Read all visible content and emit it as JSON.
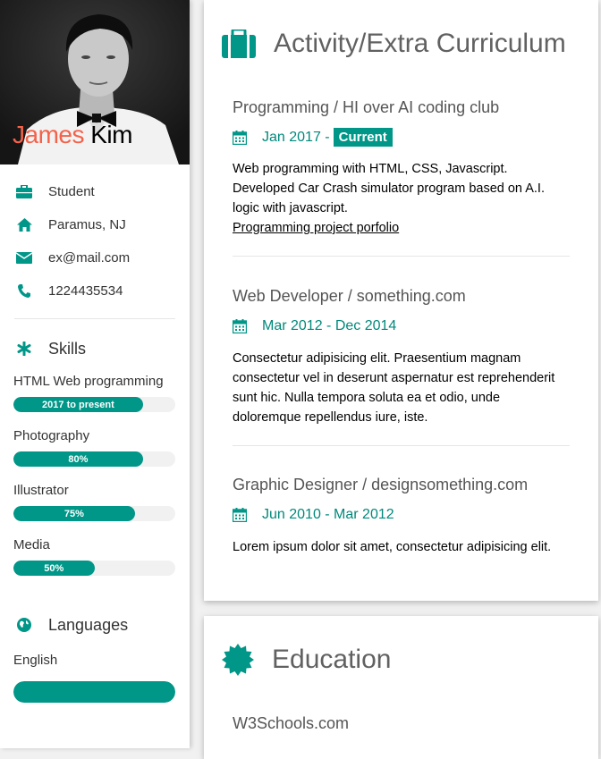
{
  "profile": {
    "first_name": "James",
    "last_name": "Kim",
    "photo_icon": "profile-photo",
    "contacts": [
      {
        "icon": "briefcase-icon",
        "text": "Student"
      },
      {
        "icon": "home-icon",
        "text": "Paramus, NJ"
      },
      {
        "icon": "envelope-icon",
        "text": "ex@mail.com"
      },
      {
        "icon": "phone-icon",
        "text": "1224435534"
      }
    ]
  },
  "skills": {
    "heading": "Skills",
    "items": [
      {
        "name": "HTML Web programming",
        "label": "2017 to present",
        "level": 0.8
      },
      {
        "name": "Photography",
        "label": "80%",
        "level": 0.8
      },
      {
        "name": "Illustrator",
        "label": "75%",
        "level": 0.75
      },
      {
        "name": "Media",
        "label": "50%",
        "level": 0.5
      }
    ]
  },
  "languages": {
    "heading": "Languages",
    "items": [
      {
        "name": "English",
        "level": 1.0
      }
    ]
  },
  "activity": {
    "heading": "Activity/Extra Curriculum",
    "entries": [
      {
        "title": "Programming / HI over AI coding club",
        "date": "Jan 2017 -",
        "badge": "Current",
        "desc": "Web programming with HTML, CSS, Javascript. Developed Car Crash simulator program based on A.I. logic with javascript.",
        "link": "Programming project porfolio"
      },
      {
        "title": "Web Developer / something.com",
        "date": "Mar 2012 - Dec 2014",
        "desc": "Consectetur adipisicing elit. Praesentium magnam consectetur vel in deserunt aspernatur est reprehenderit sunt hic. Nulla tempora soluta ea et odio, unde doloremque repellendus iure, iste."
      },
      {
        "title": "Graphic Designer / designsomething.com",
        "date": "Jun 2010 - Mar 2012",
        "desc": "Lorem ipsum dolor sit amet, consectetur adipisicing elit."
      }
    ]
  },
  "education": {
    "heading": "Education",
    "entries": [
      {
        "title": "W3Schools.com"
      }
    ]
  },
  "colors": {
    "accent": "#009688",
    "accent_text": "#00897b",
    "first_name": "#f4624a"
  }
}
